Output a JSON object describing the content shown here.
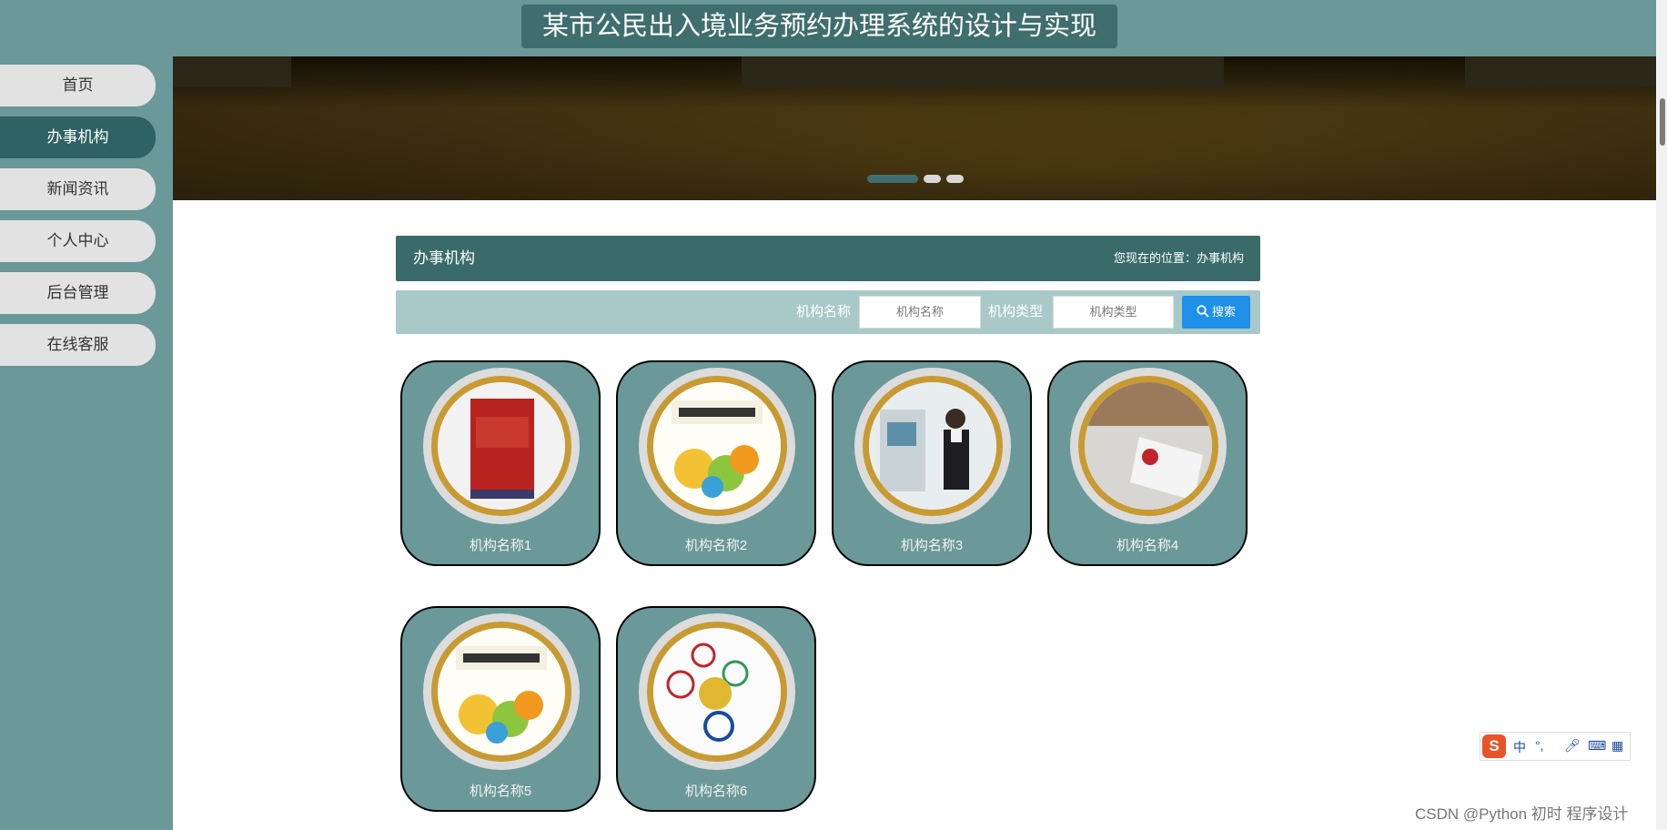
{
  "header": {
    "title": "某市公民出入境业务预约办理系统的设计与实现"
  },
  "sidebar": {
    "items": [
      {
        "label": "首页",
        "active": false
      },
      {
        "label": "办事机构",
        "active": true
      },
      {
        "label": "新闻资讯",
        "active": false
      },
      {
        "label": "个人中心",
        "active": false
      },
      {
        "label": "后台管理",
        "active": false
      },
      {
        "label": "在线客服",
        "active": false
      }
    ]
  },
  "banner": {
    "slides": 3,
    "active_slide": 1
  },
  "section": {
    "title": "办事机构",
    "breadcrumb": "您现在的位置：办事机构"
  },
  "search": {
    "name_label": "机构名称",
    "name_placeholder": "机构名称",
    "type_label": "机构类型",
    "type_placeholder": "机构类型",
    "button_label": "搜索"
  },
  "cards": [
    {
      "name": "机构名称1",
      "image": "book-cover-red"
    },
    {
      "name": "机构名称2",
      "image": "book-cover-yellow"
    },
    {
      "name": "机构名称3",
      "image": "bank-teller-photo"
    },
    {
      "name": "机构名称4",
      "image": "bank-sign-photo"
    },
    {
      "name": "机构名称5",
      "image": "book-cover-yellow"
    },
    {
      "name": "机构名称6",
      "image": "bank-logos"
    }
  ],
  "ime": {
    "mode": "中",
    "punct": "°,"
  },
  "watermark": "CSDN @Python 初时 程序设计",
  "colors": {
    "primary": "#6b9898",
    "dark": "#3a6b6b",
    "accent": "#1e90e8",
    "ring": "#c89a32"
  }
}
